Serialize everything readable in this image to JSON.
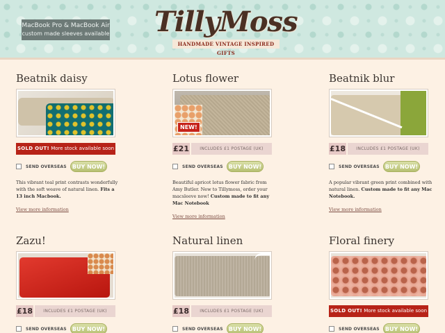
{
  "header": {
    "promo_line1": "MacBook Pro & MacBook Air",
    "promo_line2": "custom made sleeves available",
    "logo": "TillyMoss",
    "tagline": "HANDMADE VINTAGE INSPIRED GIFTS"
  },
  "common": {
    "overseas_label": "SEND OVERSEAS",
    "buy_label": "BUY NOW!",
    "postage_label": "INCLUDES £1 POSTAGE (UK)",
    "sold_out_label": "SOLD OUT!",
    "sold_out_more": "More stock available soon",
    "more_info": "View more information",
    "new_badge": "NEW!"
  },
  "products": [
    {
      "title": "Beatnik daisy",
      "desc": "This vibrant teal print contrasts wonderfully with the soft weave of natural linen.",
      "desc_bold": "Fits a 13 inch Macbook."
    },
    {
      "title": "Lotus flower",
      "price": "£21",
      "desc": "Beautiful apricot lotus flower fabric from Amy Butler. New to Tillymoss, order your macsleeve now!",
      "desc_bold": "Custom made to fit any Mac Notebook"
    },
    {
      "title": "Beatnik blur",
      "price": "£18",
      "desc": "A popular vibrant green print combined with natural linen.",
      "desc_bold": "Custom made to fit any Mac Notebook."
    },
    {
      "title": "Zazu!",
      "price": "£18"
    },
    {
      "title": "Natural linen",
      "price": "£18"
    },
    {
      "title": "Floral finery"
    }
  ]
}
